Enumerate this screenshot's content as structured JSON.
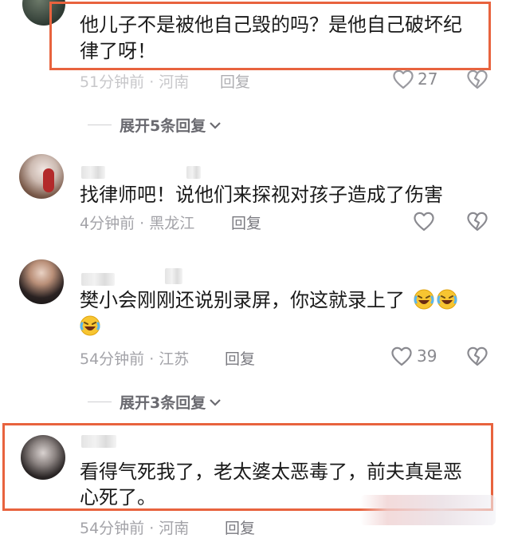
{
  "comments": [
    {
      "text_line1": "他儿子不是被他自己毁的吗？是他自己破坏纪",
      "text_line2": "律了呀！",
      "time_location": "51分钟前 · 河南",
      "reply_label": "回复",
      "likes": "27"
    },
    {
      "text_line1": "找律师吧！说他们来探视对孩子造成了伤害",
      "time_location": "4分钟前 · 黑龙江",
      "reply_label": "回复",
      "likes": ""
    },
    {
      "text_line1": "樊小会刚刚还说别录屏，你这就录上了",
      "time_location": "54分钟前 · 江苏",
      "reply_label": "回复",
      "likes": "39"
    },
    {
      "text_line1": "看得气死我了，老太婆太恶毒了，前夫真是恶",
      "text_line2": "心死了。",
      "time_location": "54分钟前 · 河南",
      "reply_label": "回复",
      "likes": ""
    }
  ],
  "expand_1": "展开5条回复",
  "expand_2": "展开3条回复",
  "icons": {
    "like": "heart-outline-icon",
    "dislike": "broken-heart-icon",
    "emoji": "laughing-crying-emoji",
    "expand": "chevron-down-icon"
  },
  "colors": {
    "highlight_box": "#e8633e",
    "meta_text": "#a3a3a8"
  }
}
